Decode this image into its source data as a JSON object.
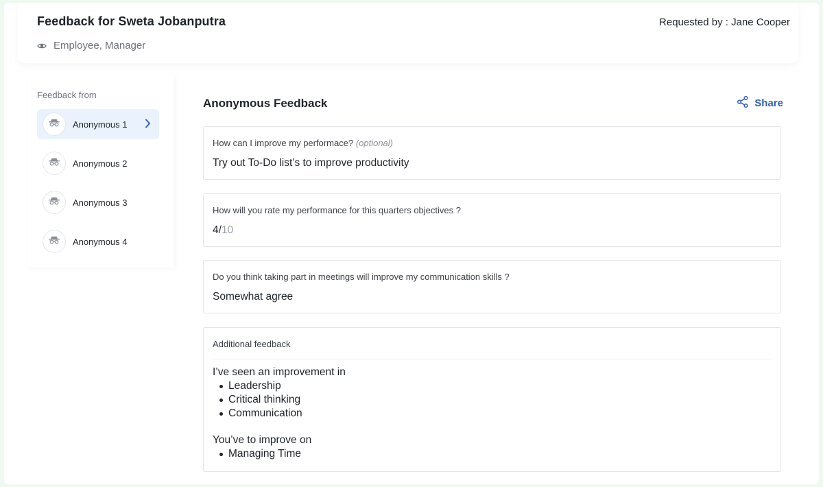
{
  "header": {
    "title": "Feedback for Sweta Jobanputra",
    "visibility": "Employee, Manager",
    "visibility_icon": "eye-icon",
    "requested_by": "Requested by : Jane Cooper"
  },
  "sidebar": {
    "label": "Feedback from",
    "items": [
      {
        "label": "Anonymous 1",
        "active": true,
        "icon": "incognito-icon"
      },
      {
        "label": "Anonymous 2",
        "active": false,
        "icon": "incognito-icon"
      },
      {
        "label": "Anonymous 3",
        "active": false,
        "icon": "incognito-icon"
      },
      {
        "label": "Anonymous 4",
        "active": false,
        "icon": "incognito-icon"
      }
    ]
  },
  "main": {
    "title": "Anonymous Feedback",
    "share_label": "Share",
    "questions": [
      {
        "question": "How can I improve my performace?",
        "optional": "(optional)",
        "answer": "Try out To-Do list’s to improve productivity"
      },
      {
        "question": "How will you rate my performance for this quarters objectives ?",
        "rating": "4/",
        "rating_max": "10"
      },
      {
        "question": "Do you think taking part in meetings will improve my communication skills ?",
        "answer": "Somewhat agree"
      }
    ],
    "additional": {
      "label": "Additional feedback",
      "improved_heading": "I’ve seen an improvement in",
      "improved_items": [
        "Leadership",
        "Critical thinking",
        "Communication"
      ],
      "to_improve_heading": "You’ve to improve on",
      "to_improve_items": [
        "Managing Time"
      ]
    }
  },
  "colors": {
    "accent": "#2f5fc4",
    "active_bg": "#eaf3fd",
    "page_bg": "#eefaf0"
  }
}
